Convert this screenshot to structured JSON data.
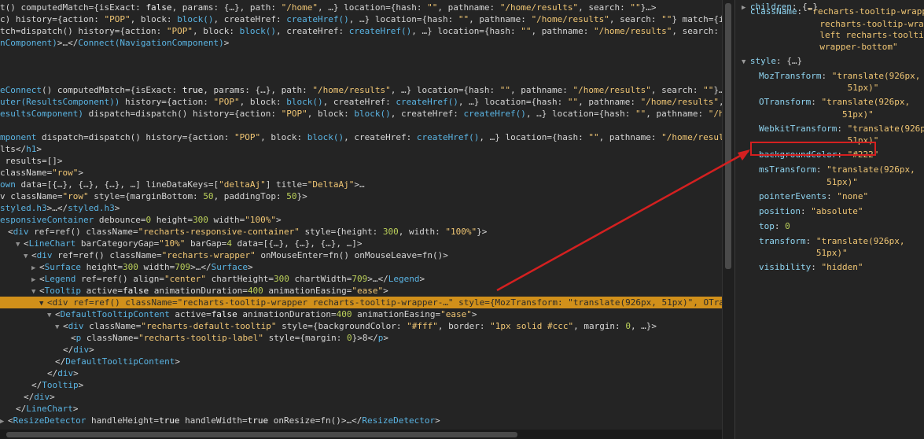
{
  "tree_lines": [
    {
      "indent": 0,
      "tw": "",
      "segs": [
        [
          "t",
          "t() computedMatch={isExact: "
        ],
        [
          "k",
          "false"
        ],
        [
          "t",
          ", params: {…}, path: "
        ],
        [
          "s",
          "\"/home\""
        ],
        [
          "t",
          ", …} location={hash: "
        ],
        [
          "s",
          "\"\""
        ],
        [
          "t",
          ", pathname: "
        ],
        [
          "s",
          "\"/home/results\""
        ],
        [
          "t",
          ", search: "
        ],
        [
          "s",
          "\"\""
        ],
        [
          "t",
          "}…>"
        ]
      ]
    },
    {
      "indent": 0,
      "tw": "",
      "segs": [
        [
          "t",
          "c) history={action: "
        ],
        [
          "s",
          "\"POP\""
        ],
        [
          "t",
          ", block: "
        ],
        [
          "f",
          "block()"
        ],
        [
          "t",
          ", createHref: "
        ],
        [
          "f",
          "createHref()"
        ],
        [
          "t",
          ", …} location={hash: "
        ],
        [
          "s",
          "\"\""
        ],
        [
          "t",
          ", pathname: "
        ],
        [
          "s",
          "\"/home/results\""
        ],
        [
          "t",
          ", search: "
        ],
        [
          "s",
          "\"\""
        ],
        [
          "t",
          "} match={isExact: "
        ],
        [
          "k",
          "false"
        ]
      ]
    },
    {
      "indent": 0,
      "tw": "",
      "segs": [
        [
          "t",
          "tch=dispatch() history={action: "
        ],
        [
          "s",
          "\"POP\""
        ],
        [
          "t",
          ", block: "
        ],
        [
          "f",
          "block()"
        ],
        [
          "t",
          ", createHref: "
        ],
        [
          "f",
          "createHref()"
        ],
        [
          "t",
          ", …} location={hash: "
        ],
        [
          "s",
          "\"\""
        ],
        [
          "t",
          ", pathname: "
        ],
        [
          "s",
          "\"/home/results\""
        ],
        [
          "t",
          ", search: "
        ],
        [
          "s",
          "\"\""
        ],
        [
          "t",
          "}…>"
        ]
      ]
    },
    {
      "indent": 0,
      "tw": "",
      "segs": [
        [
          "g",
          "nComponent)"
        ],
        [
          "t",
          ">…</"
        ],
        [
          "g",
          "Connect(NavigationComponent)"
        ],
        [
          "t",
          ">"
        ]
      ]
    },
    {
      "indent": 0,
      "tw": "",
      "segs": []
    },
    {
      "indent": 0,
      "tw": "",
      "segs": []
    },
    {
      "indent": 0,
      "tw": "",
      "segs": []
    },
    {
      "indent": 0,
      "tw": "",
      "segs": [
        [
          "g",
          "eConnect"
        ],
        [
          "t",
          "() computedMatch={isExact: "
        ],
        [
          "k",
          "true"
        ],
        [
          "t",
          ", params: {…}, path: "
        ],
        [
          "s",
          "\"/home/results\""
        ],
        [
          "t",
          ", …} location={hash: "
        ],
        [
          "s",
          "\"\""
        ],
        [
          "t",
          ", pathname: "
        ],
        [
          "s",
          "\"/home/results\""
        ],
        [
          "t",
          ", search: "
        ],
        [
          "s",
          "\"\""
        ],
        [
          "t",
          "}…>"
        ]
      ]
    },
    {
      "indent": 0,
      "tw": "",
      "segs": [
        [
          "g",
          "uter(ResultsComponent))"
        ],
        [
          "t",
          " history={action: "
        ],
        [
          "s",
          "\"POP\""
        ],
        [
          "t",
          ", block: "
        ],
        [
          "f",
          "block()"
        ],
        [
          "t",
          ", createHref: "
        ],
        [
          "f",
          "createHref()"
        ],
        [
          "t",
          ", …} location={hash: "
        ],
        [
          "s",
          "\"\""
        ],
        [
          "t",
          ", pathname: "
        ],
        [
          "s",
          "\"/home/results\""
        ],
        [
          "t",
          ", search: "
        ],
        [
          "s",
          "\"\""
        ],
        [
          "t",
          "}"
        ]
      ]
    },
    {
      "indent": 0,
      "tw": "",
      "segs": [
        [
          "g",
          "esultsComponent)"
        ],
        [
          "t",
          " dispatch=dispatch() history={action: "
        ],
        [
          "s",
          "\"POP\""
        ],
        [
          "t",
          ", block: "
        ],
        [
          "f",
          "block()"
        ],
        [
          "t",
          ", createHref: "
        ],
        [
          "f",
          "createHref()"
        ],
        [
          "t",
          ", …} location={hash: "
        ],
        [
          "s",
          "\"\""
        ],
        [
          "t",
          ", pathname: "
        ],
        [
          "s",
          "\"/home/results\""
        ]
      ]
    },
    {
      "indent": 0,
      "tw": "",
      "segs": []
    },
    {
      "indent": 0,
      "tw": "",
      "segs": [
        [
          "g",
          "mponent"
        ],
        [
          "t",
          " dispatch=dispatch() history={action: "
        ],
        [
          "s",
          "\"POP\""
        ],
        [
          "t",
          ", block: "
        ],
        [
          "f",
          "block()"
        ],
        [
          "t",
          ", createHref: "
        ],
        [
          "f",
          "createHref()"
        ],
        [
          "t",
          ", …} location={hash: "
        ],
        [
          "s",
          "\"\""
        ],
        [
          "t",
          ", pathname: "
        ],
        [
          "s",
          "\"/home/results\""
        ],
        [
          "t",
          ", search:"
        ]
      ]
    },
    {
      "indent": 0,
      "tw": "",
      "segs": [
        [
          "t",
          "lts</"
        ],
        [
          "g",
          "h1"
        ],
        [
          "t",
          ">"
        ]
      ]
    },
    {
      "indent": 0,
      "tw": "",
      "segs": [
        [
          "t",
          " results=[]>"
        ]
      ]
    },
    {
      "indent": 0,
      "tw": "",
      "segs": [
        [
          "t",
          "className="
        ],
        [
          "s",
          "\"row\""
        ],
        [
          "t",
          ">"
        ]
      ]
    },
    {
      "indent": 0,
      "tw": "",
      "segs": [
        [
          "g",
          "own"
        ],
        [
          "t",
          " data=[{…}, {…}, {…}, …] lineDataKeys=["
        ],
        [
          "s",
          "\"deltaAj\""
        ],
        [
          "t",
          "] title="
        ],
        [
          "s",
          "\"DeltaAj\""
        ],
        [
          "t",
          ">…"
        ]
      ]
    },
    {
      "indent": 0,
      "tw": "",
      "segs": [
        [
          "t",
          "v className="
        ],
        [
          "s",
          "\"row\""
        ],
        [
          "t",
          " style={marginBottom: "
        ],
        [
          "n",
          "50"
        ],
        [
          "t",
          ", paddingTop: "
        ],
        [
          "n",
          "50"
        ],
        [
          "t",
          "}>"
        ]
      ]
    },
    {
      "indent": 0,
      "tw": "",
      "segs": [
        [
          "g",
          "styled.h3"
        ],
        [
          "t",
          ">…</"
        ],
        [
          "g",
          "styled.h3"
        ],
        [
          "t",
          ">"
        ]
      ]
    },
    {
      "indent": 0,
      "tw": "",
      "segs": [
        [
          "g",
          "esponsiveContainer"
        ],
        [
          "t",
          " debounce="
        ],
        [
          "n",
          "0"
        ],
        [
          "t",
          " height="
        ],
        [
          "n",
          "300"
        ],
        [
          "t",
          " width="
        ],
        [
          "s",
          "\"100%\""
        ],
        [
          "t",
          ">"
        ]
      ]
    },
    {
      "indent": 1,
      "tw": "",
      "segs": [
        [
          "t",
          "<"
        ],
        [
          "g",
          "div"
        ],
        [
          "t",
          " ref=ref() className="
        ],
        [
          "s",
          "\"recharts-responsive-container\""
        ],
        [
          "t",
          " style={height: "
        ],
        [
          "n",
          "300"
        ],
        [
          "t",
          ", width: "
        ],
        [
          "s",
          "\"100%\""
        ],
        [
          "t",
          "}>"
        ]
      ]
    },
    {
      "indent": 2,
      "tw": "▼",
      "segs": [
        [
          "t",
          "<"
        ],
        [
          "g",
          "LineChart"
        ],
        [
          "t",
          " barCategoryGap="
        ],
        [
          "s",
          "\"10%\""
        ],
        [
          "t",
          " barGap="
        ],
        [
          "n",
          "4"
        ],
        [
          "t",
          " data=[{…}, {…}, {…}, …]>"
        ]
      ]
    },
    {
      "indent": 3,
      "tw": "▼",
      "segs": [
        [
          "t",
          "<"
        ],
        [
          "g",
          "div"
        ],
        [
          "t",
          " ref=ref() className="
        ],
        [
          "s",
          "\"recharts-wrapper\""
        ],
        [
          "t",
          " onMouseEnter=fn() onMouseLeave=fn()>"
        ]
      ]
    },
    {
      "indent": 4,
      "tw": "▶",
      "segs": [
        [
          "t",
          "<"
        ],
        [
          "g",
          "Surface"
        ],
        [
          "t",
          " height="
        ],
        [
          "n",
          "300"
        ],
        [
          "t",
          " width="
        ],
        [
          "n",
          "709"
        ],
        [
          "t",
          ">…</"
        ],
        [
          "g",
          "Surface"
        ],
        [
          "t",
          ">"
        ]
      ]
    },
    {
      "indent": 4,
      "tw": "▶",
      "segs": [
        [
          "t",
          "<"
        ],
        [
          "g",
          "Legend"
        ],
        [
          "t",
          " ref=ref() align="
        ],
        [
          "s",
          "\"center\""
        ],
        [
          "t",
          " chartHeight="
        ],
        [
          "n",
          "300"
        ],
        [
          "t",
          " chartWidth="
        ],
        [
          "n",
          "709"
        ],
        [
          "t",
          ">…</"
        ],
        [
          "g",
          "Legend"
        ],
        [
          "t",
          ">"
        ]
      ]
    },
    {
      "indent": 4,
      "tw": "▼",
      "segs": [
        [
          "t",
          "<"
        ],
        [
          "g",
          "Tooltip"
        ],
        [
          "t",
          " active="
        ],
        [
          "k",
          "false"
        ],
        [
          "t",
          " animationDuration="
        ],
        [
          "n",
          "400"
        ],
        [
          "t",
          " animationEasing="
        ],
        [
          "s",
          "\"ease\""
        ],
        [
          "t",
          ">"
        ]
      ]
    },
    {
      "indent": 5,
      "tw": "▼",
      "sel": true,
      "segs": [
        [
          "t",
          "<div ref=ref() className=\"recharts-tooltip-wrapper recharts-tooltip-wrapper-…\" style={MozTransform: \"translate(926px, 51px)\", OTransform: \"transl"
        ]
      ]
    },
    {
      "indent": 6,
      "tw": "▼",
      "segs": [
        [
          "t",
          "<"
        ],
        [
          "g",
          "DefaultTooltipContent"
        ],
        [
          "t",
          " active="
        ],
        [
          "k",
          "false"
        ],
        [
          "t",
          " animationDuration="
        ],
        [
          "n",
          "400"
        ],
        [
          "t",
          " animationEasing="
        ],
        [
          "s",
          "\"ease\""
        ],
        [
          "t",
          ">"
        ]
      ]
    },
    {
      "indent": 7,
      "tw": "▼",
      "segs": [
        [
          "t",
          "<"
        ],
        [
          "g",
          "div"
        ],
        [
          "t",
          " className="
        ],
        [
          "s",
          "\"recharts-default-tooltip\""
        ],
        [
          "t",
          " style={backgroundColor: "
        ],
        [
          "s",
          "\"#fff\""
        ],
        [
          "t",
          ", border: "
        ],
        [
          "s",
          "\"1px solid #ccc\""
        ],
        [
          "t",
          ", margin: "
        ],
        [
          "n",
          "0"
        ],
        [
          "t",
          ", …}>"
        ]
      ]
    },
    {
      "indent": 9,
      "tw": "",
      "segs": [
        [
          "t",
          "<"
        ],
        [
          "g",
          "p"
        ],
        [
          "t",
          " className="
        ],
        [
          "s",
          "\"recharts-tooltip-label\""
        ],
        [
          "t",
          " style={margin: "
        ],
        [
          "n",
          "0"
        ],
        [
          "t",
          "}>8</"
        ],
        [
          "g",
          "p"
        ],
        [
          "t",
          ">"
        ]
      ]
    },
    {
      "indent": 8,
      "tw": "",
      "segs": [
        [
          "t",
          "</"
        ],
        [
          "g",
          "div"
        ],
        [
          "t",
          ">"
        ]
      ]
    },
    {
      "indent": 7,
      "tw": "",
      "segs": [
        [
          "t",
          "</"
        ],
        [
          "g",
          "DefaultTooltipContent"
        ],
        [
          "t",
          ">"
        ]
      ]
    },
    {
      "indent": 6,
      "tw": "",
      "segs": [
        [
          "t",
          "</"
        ],
        [
          "g",
          "div"
        ],
        [
          "t",
          ">"
        ]
      ]
    },
    {
      "indent": 4,
      "tw": "",
      "segs": [
        [
          "t",
          "</"
        ],
        [
          "g",
          "Tooltip"
        ],
        [
          "t",
          ">"
        ]
      ]
    },
    {
      "indent": 3,
      "tw": "",
      "segs": [
        [
          "t",
          "</"
        ],
        [
          "g",
          "div"
        ],
        [
          "t",
          ">"
        ]
      ]
    },
    {
      "indent": 2,
      "tw": "",
      "segs": [
        [
          "t",
          "</"
        ],
        [
          "g",
          "LineChart"
        ],
        [
          "t",
          ">"
        ]
      ]
    },
    {
      "indent": 0,
      "tw": "▶",
      "segs": [
        [
          "t",
          "<"
        ],
        [
          "g",
          "ResizeDetector"
        ],
        [
          "t",
          " handleHeight="
        ],
        [
          "k",
          "true"
        ],
        [
          "t",
          " handleWidth="
        ],
        [
          "k",
          "true"
        ],
        [
          "t",
          " onResize=fn()>…</"
        ],
        [
          "g",
          "ResizeDetector"
        ],
        [
          "t",
          ">"
        ]
      ]
    }
  ],
  "props": [
    {
      "tw": "▶",
      "key": "children",
      "val": "{…}",
      "vt": "t",
      "indent": 0
    },
    {
      "tw": "",
      "key": "className",
      "val": "\"recharts-tooltip-wrapper\n               recharts-tooltip-wrapper-\n               left recharts-tooltip-\n               wrapper-bottom\"",
      "vt": "s",
      "indent": 0
    },
    {
      "tw": "▼",
      "key": "style",
      "val": "{…}",
      "vt": "t",
      "indent": 0
    },
    {
      "tw": "",
      "key": "MozTransform",
      "val": "\"translate(926px,\n                 51px)\"",
      "vt": "s",
      "indent": 1
    },
    {
      "tw": "",
      "key": "OTransform",
      "val": "\"translate(926px,\n                51px)\"",
      "vt": "s",
      "indent": 1
    },
    {
      "tw": "",
      "key": "WebkitTransform",
      "val": "\"translate(926px,\n                 51px)\"",
      "vt": "s",
      "indent": 1
    },
    {
      "tw": "",
      "key": "backgroundColor",
      "val": "\"#222\"",
      "vt": "s",
      "indent": 1,
      "highlight": true
    },
    {
      "tw": "",
      "key": "msTransform",
      "val": "\"translate(926px,\n             51px)\"",
      "vt": "s",
      "indent": 1
    },
    {
      "tw": "",
      "key": "pointerEvents",
      "val": "\"none\"",
      "vt": "s",
      "indent": 1
    },
    {
      "tw": "",
      "key": "position",
      "val": "\"absolute\"",
      "vt": "s",
      "indent": 1
    },
    {
      "tw": "",
      "key": "top",
      "val": "0",
      "vt": "n",
      "indent": 1
    },
    {
      "tw": "",
      "key": "transform",
      "val": "\"translate(926px,\n           51px)\"",
      "vt": "s",
      "indent": 1
    },
    {
      "tw": "",
      "key": "visibility",
      "val": "\"hidden\"",
      "vt": "s",
      "indent": 1
    }
  ],
  "colors": {
    "background": "#242424",
    "selection": "#d1901a",
    "annotation": "#d42020",
    "tag": "#5ab4e3",
    "string": "#f0c674",
    "number": "#bbd05a"
  },
  "icons": {
    "expand": "triangle-right-icon",
    "collapse": "triangle-down-icon"
  }
}
